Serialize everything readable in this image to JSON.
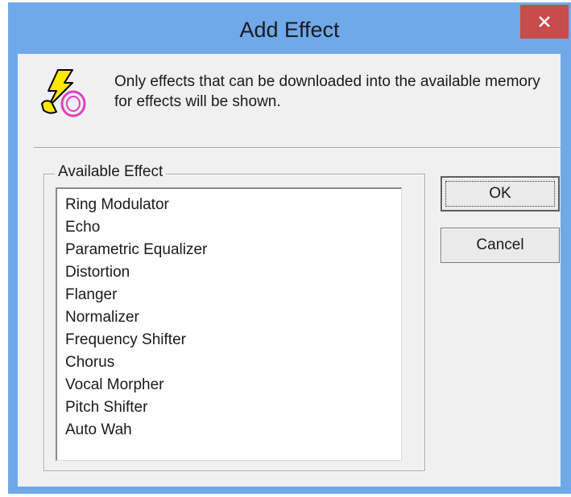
{
  "window": {
    "title": "Add Effect",
    "close_symbol": "✕"
  },
  "info": {
    "icon": "lightning-effect-icon",
    "text": "Only effects that can be downloaded into the available memory for effects will be shown."
  },
  "group": {
    "label": "Available Effect",
    "items": [
      "Ring Modulator",
      "Echo",
      "Parametric Equalizer",
      "Distortion",
      "Flanger",
      "Normalizer",
      "Frequency Shifter",
      "Chorus",
      "Vocal Morpher",
      "Pitch Shifter",
      "Auto Wah"
    ]
  },
  "buttons": {
    "ok": "OK",
    "cancel": "Cancel"
  },
  "colors": {
    "titlebar": "#6fa9ea",
    "close": "#c74c4c",
    "client": "#f0f0f0"
  }
}
